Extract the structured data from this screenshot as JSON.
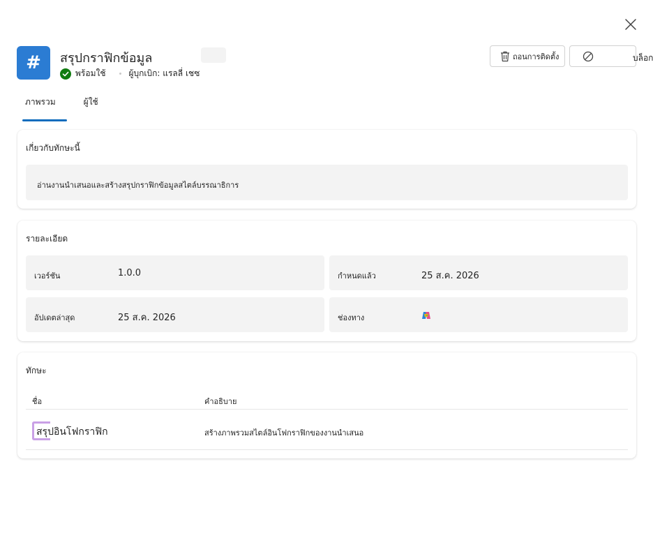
{
  "header": {
    "app_icon_glyph": "#",
    "title": "สรุปกราฟิกข้อมูล",
    "status": "พร้อมใช้",
    "publisher": "ผู้บุกเบิก: แรลลี่ เชซ",
    "uninstall_label": "ถอนการติดตั้ง",
    "block_label": "บล็อก"
  },
  "tabs": [
    {
      "label": "ภาพรวม",
      "active": true
    },
    {
      "label": "ผู้ใช้",
      "active": false
    }
  ],
  "about": {
    "heading": "เกี่ยวกับทักษะนี้",
    "description": "อ่านงานนำเสนอและสร้างสรุปกราฟิกข้อมูลสไตล์บรรณาธิการ"
  },
  "details": {
    "heading": "รายละเอียด",
    "version_label": "เวอร์ชัน",
    "version_value": "1.0.0",
    "assigned_label": "กำหนดแล้ว",
    "assigned_value": "25 ส.ค. 2026",
    "updated_label": "อัปเดตล่าสุด",
    "updated_value": "25 ส.ค. 2026",
    "channel_label": "ช่องทาง",
    "channel_icon": "copilot-icon"
  },
  "skills": {
    "heading": "ทักษะ",
    "col_name": "ชื่อ",
    "col_description": "คำอธิบาย",
    "rows": [
      {
        "name": "สรุปอินโฟกราฟิก",
        "description": "สร้างภาพรวมสไตล์อินโฟกราฟิกของงานนำเสนอ"
      }
    ]
  },
  "colors": {
    "accent": "#0f6cbd",
    "app_icon": "#2b7cd3",
    "status_ok": "#107c10",
    "skill_mark": "#c9a0e6"
  }
}
